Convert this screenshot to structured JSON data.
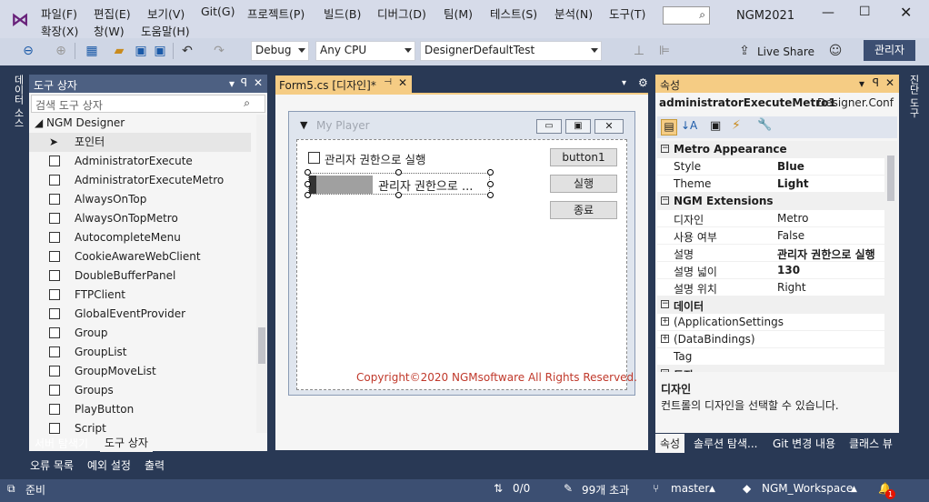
{
  "menu": [
    "파일(F)",
    "편집(E)",
    "보기(V)",
    "Git(G)",
    "프로젝트(P)",
    "빌드(B)",
    "디버그(D)",
    "팀(M)",
    "테스트(S)",
    "분석(N)",
    "도구(T)"
  ],
  "menu2": [
    "확장(X)",
    "창(W)",
    "도움말(H)"
  ],
  "app_title": "NGM2021",
  "toolbar": {
    "config": "Debug",
    "platform": "Any CPU",
    "startup": "DesignerDefaultTest",
    "live_share": "Live Share",
    "admin": "관리자"
  },
  "toolbox": {
    "title": "도구 상자",
    "search_placeholder": "검색 도구 상자",
    "group": "NGM Designer",
    "pointer": "포인터",
    "items": [
      "AdministratorExecute",
      "AdministratorExecuteMetro",
      "AlwaysOnTop",
      "AlwaysOnTopMetro",
      "AutocompleteMenu",
      "CookieAwareWebClient",
      "DoubleBufferPanel",
      "FTPClient",
      "GlobalEventProvider",
      "Group",
      "GroupList",
      "GroupMoveList",
      "Groups",
      "PlayButton",
      "Script"
    ],
    "tab_server": "서버 탐색기",
    "tab_toolbox": "도구 상자"
  },
  "left_vtab": "데이터 소스",
  "right_vtab": "진단 도구",
  "doc_tab": "Form5.cs [디자인]*",
  "form": {
    "title": "My Player",
    "checkbox": "관리자 권한으로 실행",
    "metro_label": "관리자 권한으로 ...",
    "btn1": "button1",
    "btn2": "실행",
    "btn3": "종료",
    "copyright": "Copyright©2020 NGMsoftware All Rights Reserved."
  },
  "props": {
    "title": "속성",
    "object": "administratorExecuteMetro1",
    "type": "Designer.Conf",
    "cat1": "Metro Appearance",
    "style_k": "Style",
    "style_v": "Blue",
    "theme_k": "Theme",
    "theme_v": "Light",
    "cat2": "NGM Extensions",
    "design_k": "디자인",
    "design_v": "Metro",
    "use_k": "사용 여부",
    "use_v": "False",
    "desc_k": "설명",
    "desc_v": "관리자 권한으로 실행",
    "width_k": "설명 넓이",
    "width_v": "130",
    "pos_k": "설명 위치",
    "pos_v": "Right",
    "cat3": "데이터",
    "appset": "(ApplicationSettings",
    "databind": "(DataBindings)",
    "tag": "Tag",
    "cat4": "동작",
    "help_title": "디자인",
    "help_text": "컨트롤의 디자인을 선택할 수 있습니다.",
    "tabs": [
      "속성",
      "솔루션 탐색...",
      "Git 변경 내용",
      "클래스 뷰"
    ]
  },
  "bottom_tabs": [
    "오류 목록",
    "예외 설정",
    "출력"
  ],
  "status": {
    "ready": "준비",
    "updown": "0/0",
    "changes": "99개 초과",
    "branch": "master",
    "workspace": "NGM_Workspace",
    "notif": "1"
  }
}
